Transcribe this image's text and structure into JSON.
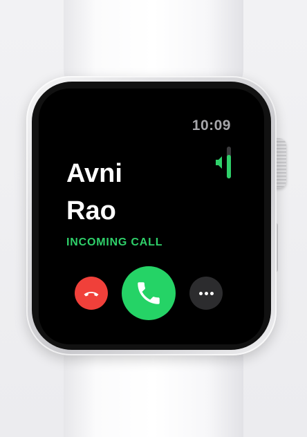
{
  "watch_screen": {
    "time": "10:09",
    "caller_first": "Avni",
    "caller_last": "Rao",
    "status": "INCOMING CALL"
  },
  "icons": {
    "volume": "volume-icon",
    "decline": "phone-down-icon",
    "accept": "phone-icon",
    "more": "more-dots-icon"
  },
  "colors": {
    "accent_green": "#2fd06a",
    "accept_button": "#25d366",
    "decline_button": "#f0403a",
    "more_button": "#2c2c2e",
    "time_text": "#a6a6aa"
  }
}
